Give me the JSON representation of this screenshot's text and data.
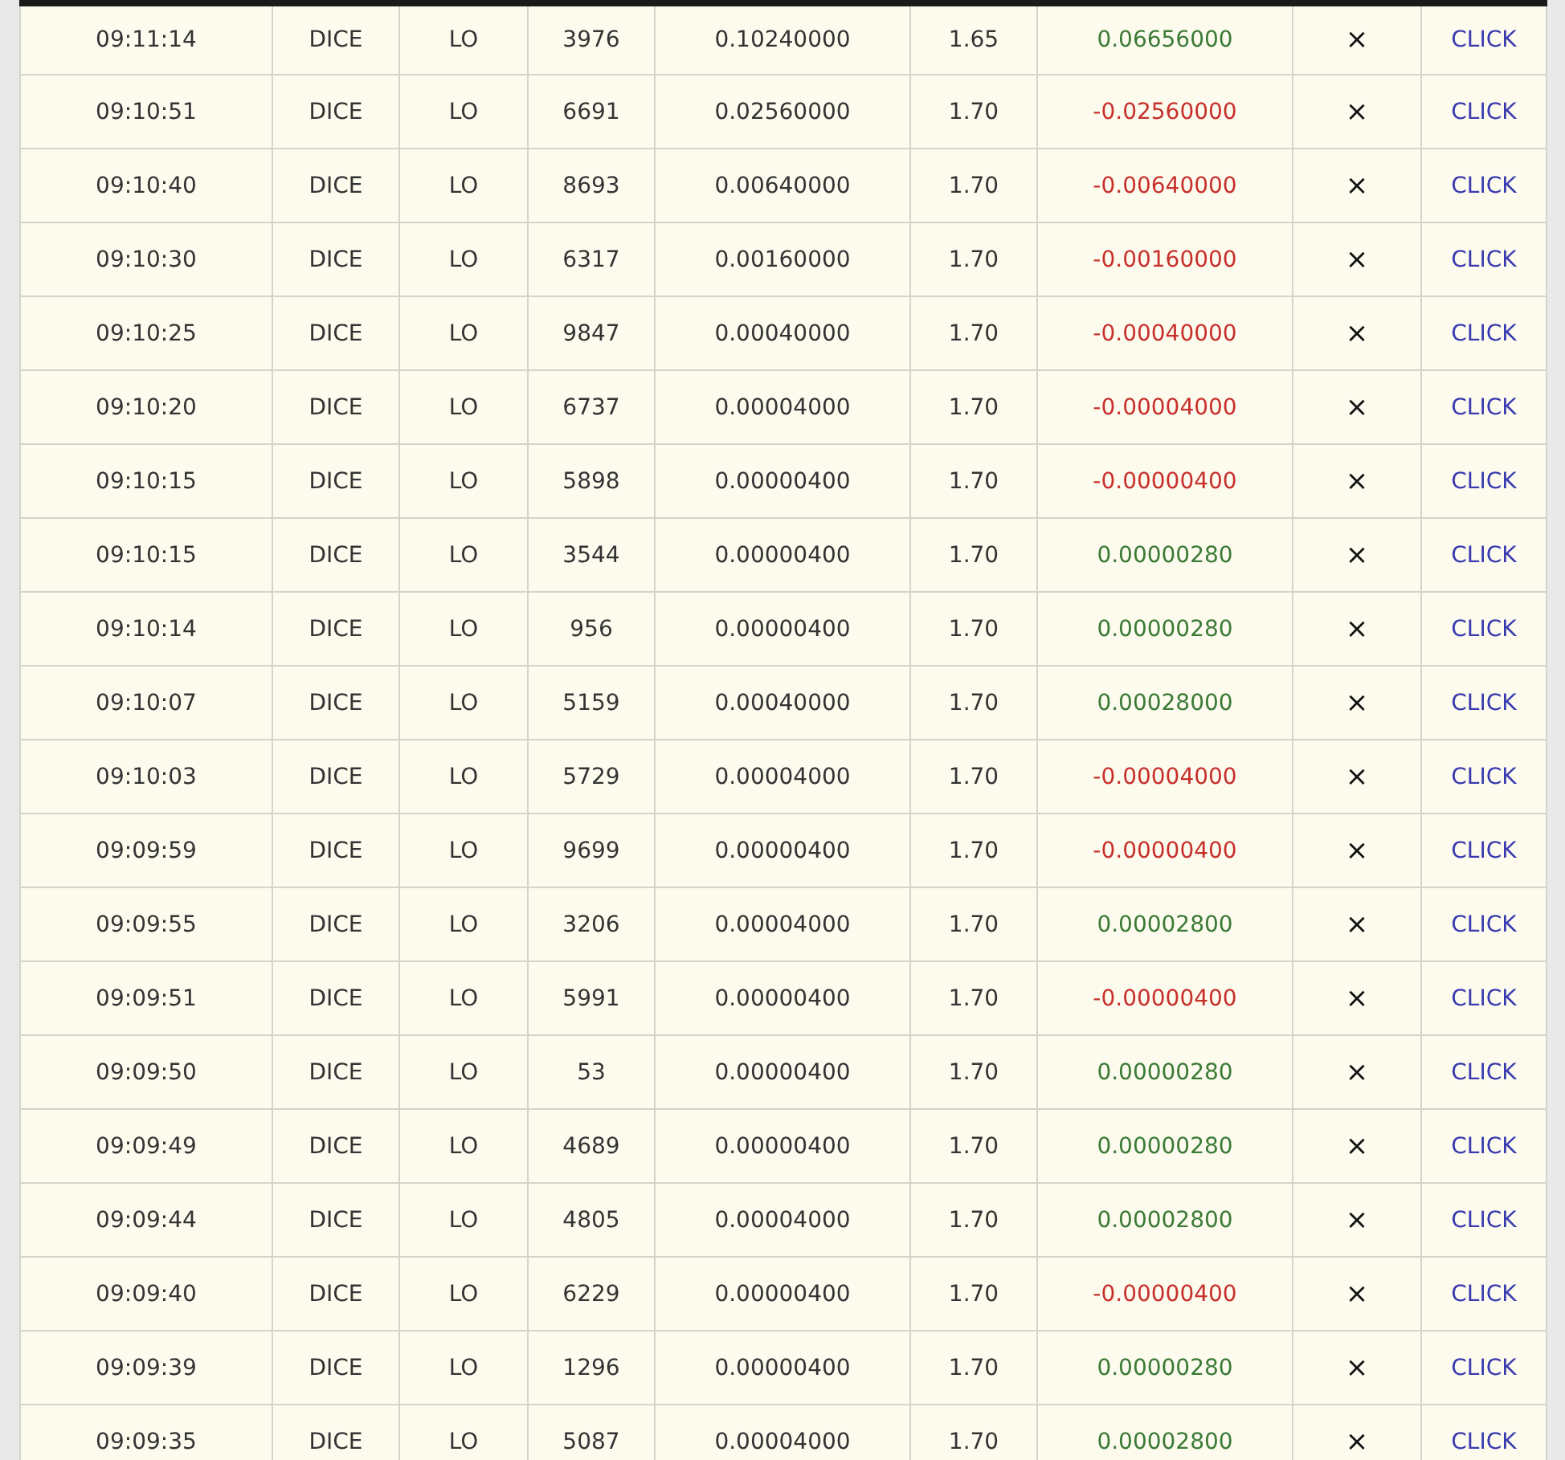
{
  "rows": [
    {
      "time": "09:11:14",
      "game": "DICE",
      "bet": "LO",
      "roll": "3976",
      "amount": "0.10240000",
      "payout": "1.65",
      "profit": "0.06656000",
      "color": "#3a7a35",
      "mark": "×",
      "link": "CLICK"
    },
    {
      "time": "09:10:51",
      "game": "DICE",
      "bet": "LO",
      "roll": "6691",
      "amount": "0.02560000",
      "payout": "1.70",
      "profit": "-0.02560000",
      "color": "#c8302c",
      "mark": "×",
      "link": "CLICK"
    },
    {
      "time": "09:10:40",
      "game": "DICE",
      "bet": "LO",
      "roll": "8693",
      "amount": "0.00640000",
      "payout": "1.70",
      "profit": "-0.00640000",
      "color": "#c8302c",
      "mark": "×",
      "link": "CLICK"
    },
    {
      "time": "09:10:30",
      "game": "DICE",
      "bet": "LO",
      "roll": "6317",
      "amount": "0.00160000",
      "payout": "1.70",
      "profit": "-0.00160000",
      "color": "#c8302c",
      "mark": "×",
      "link": "CLICK"
    },
    {
      "time": "09:10:25",
      "game": "DICE",
      "bet": "LO",
      "roll": "9847",
      "amount": "0.00040000",
      "payout": "1.70",
      "profit": "-0.00040000",
      "color": "#c8302c",
      "mark": "×",
      "link": "CLICK"
    },
    {
      "time": "09:10:20",
      "game": "DICE",
      "bet": "LO",
      "roll": "6737",
      "amount": "0.00004000",
      "payout": "1.70",
      "profit": "-0.00004000",
      "color": "#c8302c",
      "mark": "×",
      "link": "CLICK"
    },
    {
      "time": "09:10:15",
      "game": "DICE",
      "bet": "LO",
      "roll": "5898",
      "amount": "0.00000400",
      "payout": "1.70",
      "profit": "-0.00000400",
      "color": "#c8302c",
      "mark": "×",
      "link": "CLICK"
    },
    {
      "time": "09:10:15",
      "game": "DICE",
      "bet": "LO",
      "roll": "3544",
      "amount": "0.00000400",
      "payout": "1.70",
      "profit": "0.00000280",
      "color": "#3a7a35",
      "mark": "×",
      "link": "CLICK"
    },
    {
      "time": "09:10:14",
      "game": "DICE",
      "bet": "LO",
      "roll": "956",
      "amount": "0.00000400",
      "payout": "1.70",
      "profit": "0.00000280",
      "color": "#3a7a35",
      "mark": "×",
      "link": "CLICK"
    },
    {
      "time": "09:10:07",
      "game": "DICE",
      "bet": "LO",
      "roll": "5159",
      "amount": "0.00040000",
      "payout": "1.70",
      "profit": "0.00028000",
      "color": "#3a7a35",
      "mark": "×",
      "link": "CLICK"
    },
    {
      "time": "09:10:03",
      "game": "DICE",
      "bet": "LO",
      "roll": "5729",
      "amount": "0.00004000",
      "payout": "1.70",
      "profit": "-0.00004000",
      "color": "#c8302c",
      "mark": "×",
      "link": "CLICK"
    },
    {
      "time": "09:09:59",
      "game": "DICE",
      "bet": "LO",
      "roll": "9699",
      "amount": "0.00000400",
      "payout": "1.70",
      "profit": "-0.00000400",
      "color": "#c8302c",
      "mark": "×",
      "link": "CLICK"
    },
    {
      "time": "09:09:55",
      "game": "DICE",
      "bet": "LO",
      "roll": "3206",
      "amount": "0.00004000",
      "payout": "1.70",
      "profit": "0.00002800",
      "color": "#3a7a35",
      "mark": "×",
      "link": "CLICK"
    },
    {
      "time": "09:09:51",
      "game": "DICE",
      "bet": "LO",
      "roll": "5991",
      "amount": "0.00000400",
      "payout": "1.70",
      "profit": "-0.00000400",
      "color": "#c8302c",
      "mark": "×",
      "link": "CLICK"
    },
    {
      "time": "09:09:50",
      "game": "DICE",
      "bet": "LO",
      "roll": "53",
      "amount": "0.00000400",
      "payout": "1.70",
      "profit": "0.00000280",
      "color": "#3a7a35",
      "mark": "×",
      "link": "CLICK"
    },
    {
      "time": "09:09:49",
      "game": "DICE",
      "bet": "LO",
      "roll": "4689",
      "amount": "0.00000400",
      "payout": "1.70",
      "profit": "0.00000280",
      "color": "#3a7a35",
      "mark": "×",
      "link": "CLICK"
    },
    {
      "time": "09:09:44",
      "game": "DICE",
      "bet": "LO",
      "roll": "4805",
      "amount": "0.00004000",
      "payout": "1.70",
      "profit": "0.00002800",
      "color": "#3a7a35",
      "mark": "×",
      "link": "CLICK"
    },
    {
      "time": "09:09:40",
      "game": "DICE",
      "bet": "LO",
      "roll": "6229",
      "amount": "0.00000400",
      "payout": "1.70",
      "profit": "-0.00000400",
      "color": "#c8302c",
      "mark": "×",
      "link": "CLICK"
    },
    {
      "time": "09:09:39",
      "game": "DICE",
      "bet": "LO",
      "roll": "1296",
      "amount": "0.00000400",
      "payout": "1.70",
      "profit": "0.00000280",
      "color": "#3a7a35",
      "mark": "×",
      "link": "CLICK"
    },
    {
      "time": "09:09:35",
      "game": "DICE",
      "bet": "LO",
      "roll": "5087",
      "amount": "0.00004000",
      "payout": "1.70",
      "profit": "0.00002800",
      "color": "#3a7a35",
      "mark": "×",
      "link": "CLICK"
    }
  ]
}
